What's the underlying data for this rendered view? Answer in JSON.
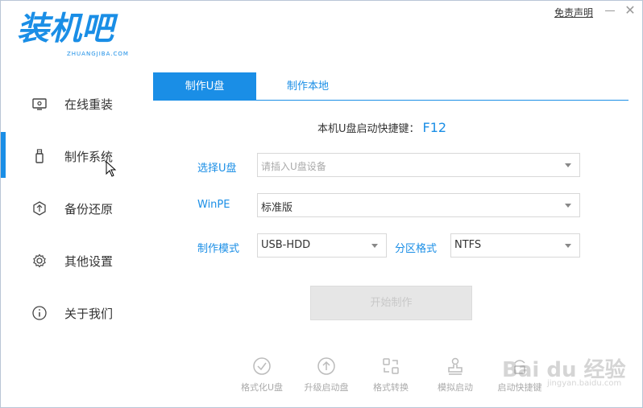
{
  "brand": {
    "logo_text": "装机吧",
    "logo_sub": "ZHUANGJIBA.COM",
    "color": "#1a8ee6"
  },
  "titlebar": {
    "disclaimer": "免责声明",
    "minimize": "—",
    "close": "✕"
  },
  "sidebar": {
    "active_index": 1,
    "items": [
      {
        "label": "在线重装",
        "icon": "monitor-icon"
      },
      {
        "label": "制作系统",
        "icon": "usb-icon"
      },
      {
        "label": "备份还原",
        "icon": "backup-icon"
      },
      {
        "label": "其他设置",
        "icon": "gear-icon"
      },
      {
        "label": "关于我们",
        "icon": "info-icon"
      }
    ]
  },
  "tabs": [
    {
      "label": "制作U盘",
      "active": true
    },
    {
      "label": "制作本地",
      "active": false
    }
  ],
  "hotkey": {
    "label": "本机U盘启动快捷键：",
    "key": "F12"
  },
  "form": {
    "usb": {
      "label": "选择U盘",
      "placeholder": "请插入U盘设备"
    },
    "winpe": {
      "label": "WinPE",
      "value": "标准版"
    },
    "mode": {
      "label": "制作模式",
      "value": "USB-HDD"
    },
    "partition": {
      "label": "分区格式",
      "value": "NTFS"
    }
  },
  "start_button": "开始制作",
  "tools": [
    {
      "label": "格式化U盘",
      "icon": "check-circle-icon"
    },
    {
      "label": "升级启动盘",
      "icon": "upload-circle-icon"
    },
    {
      "label": "格式转换",
      "icon": "convert-icon"
    },
    {
      "label": "模拟启动",
      "icon": "stamp-icon"
    },
    {
      "label": "启动快捷键",
      "icon": "key-icon"
    }
  ],
  "watermark": {
    "text": "Bai du 经验",
    "url": "jingyan.baidu.com"
  }
}
